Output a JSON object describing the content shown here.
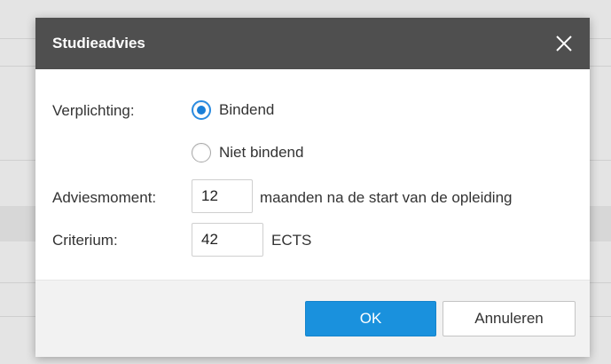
{
  "dialog": {
    "title": "Studieadvies",
    "obligation": {
      "label": "Verplichting:",
      "options": [
        {
          "label": "Bindend",
          "checked": true
        },
        {
          "label": "Niet bindend",
          "checked": false
        }
      ]
    },
    "advice_moment": {
      "label": "Adviesmoment:",
      "value": "12",
      "suffix": "maanden na de start van de opleiding"
    },
    "criterion": {
      "label": "Criterium:",
      "value": "42",
      "suffix": "ECTS"
    },
    "buttons": {
      "ok": "OK",
      "cancel": "Annuleren"
    }
  },
  "colors": {
    "titlebar": "#4f4f4f",
    "accent": "#1a91dd",
    "radio_selected": "#1a7fd8",
    "footer": "#f2f2f2"
  },
  "icons": {
    "close": "close-icon"
  }
}
